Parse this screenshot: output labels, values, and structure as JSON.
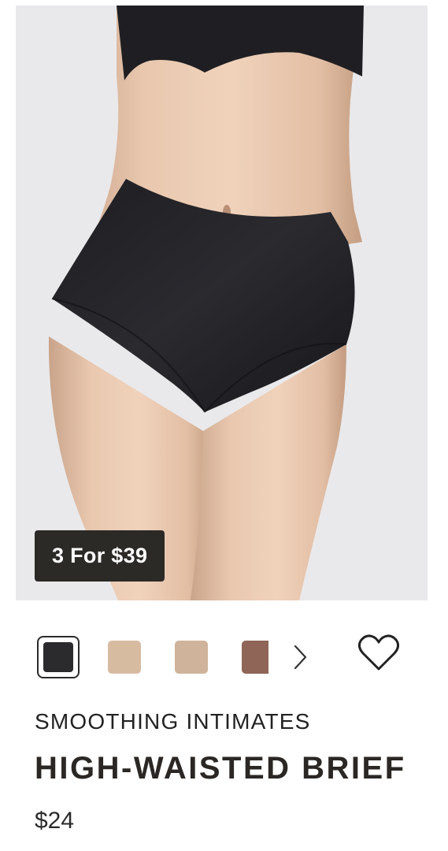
{
  "product": {
    "promo_badge": "3 For $39",
    "brand": "SMOOTHING INTIMATES",
    "name": "HIGH-WAISTED BRIEF",
    "price": "$24",
    "image_alt": "Model wearing black high-waisted brief",
    "swatches": [
      {
        "color": "#2b2b2e",
        "selected": true
      },
      {
        "color": "#d7bba1",
        "selected": false
      },
      {
        "color": "#cfb39a",
        "selected": false
      },
      {
        "color": "#8e6556",
        "selected": false
      }
    ]
  },
  "icons": {
    "next": "chevron-right-icon",
    "wishlist": "heart-outline-icon"
  },
  "colors": {
    "badge_bg": "#2c2a27",
    "text": "#222222"
  }
}
